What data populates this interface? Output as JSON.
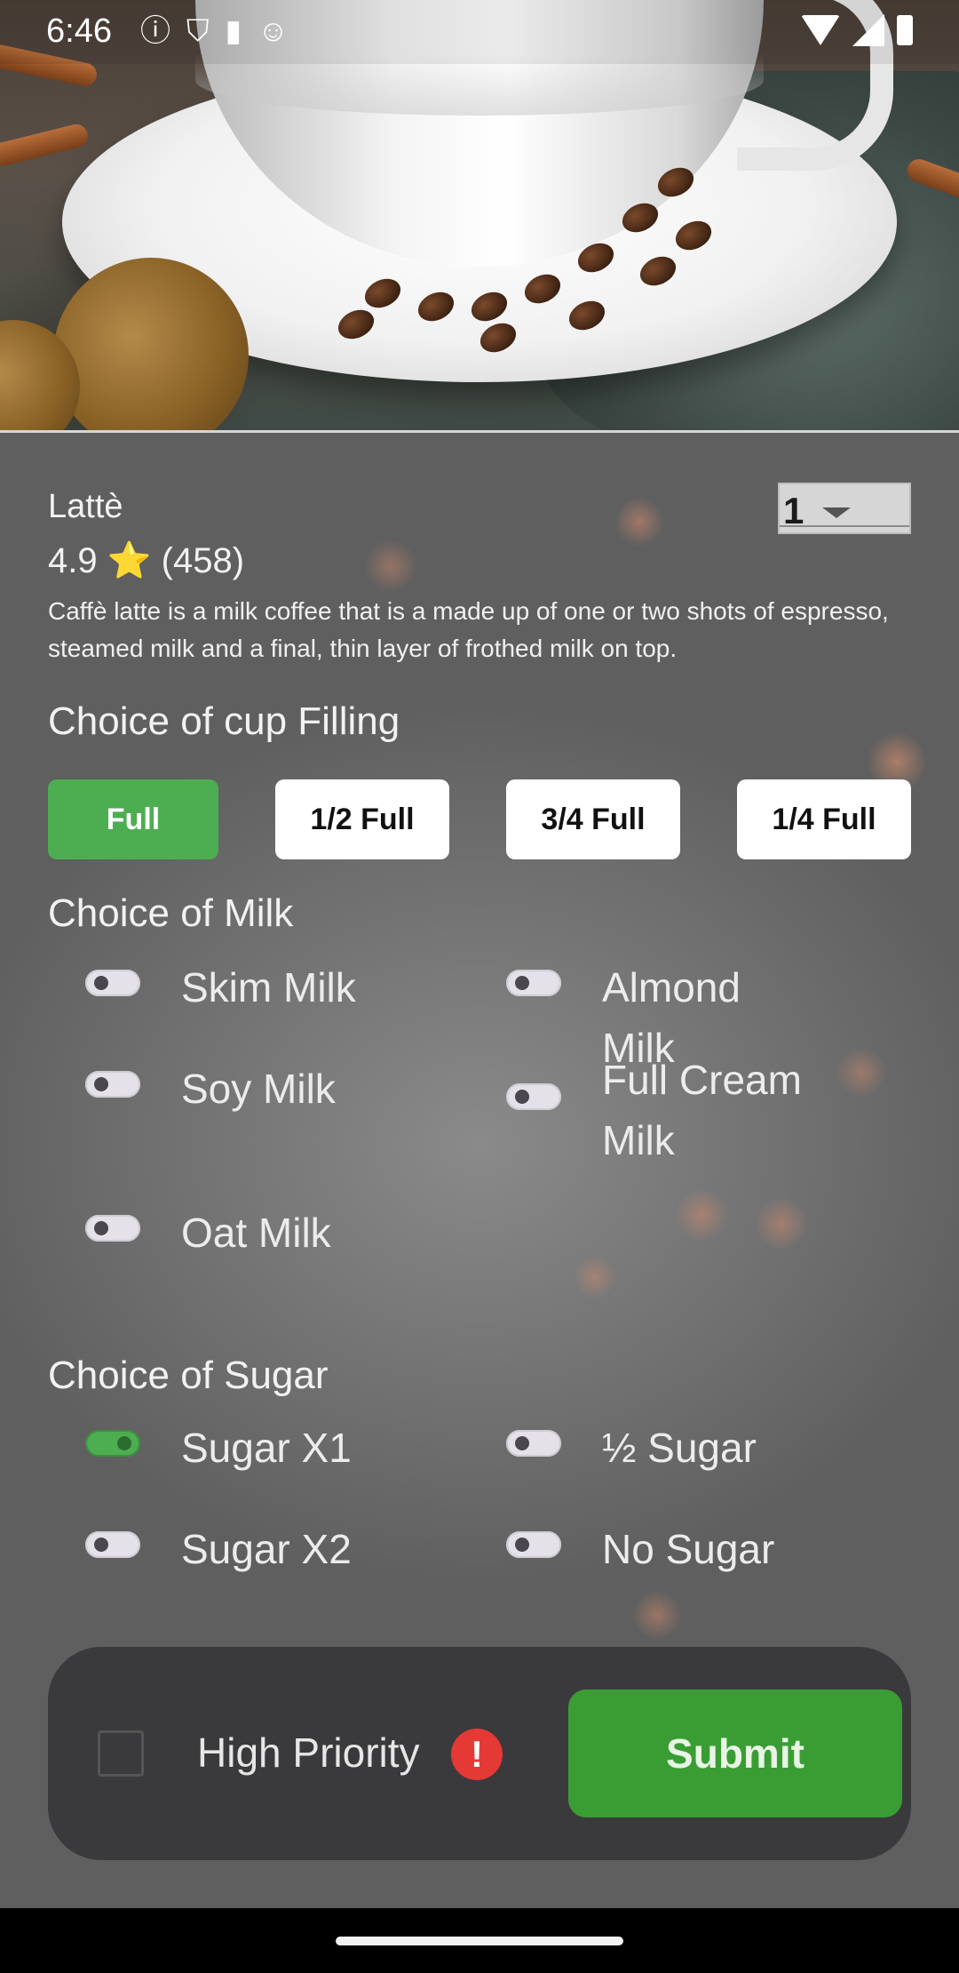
{
  "status_bar": {
    "time": "6:46",
    "notification_icons": [
      "info-icon",
      "shield-icon",
      "sd-card-icon",
      "cat-face-icon"
    ],
    "system_icons": [
      "wifi-icon",
      "signal-icon",
      "battery-icon"
    ]
  },
  "product": {
    "name": "Lattè",
    "rating_text": "4.9 ⭐ (458)",
    "description": "Caffè latte is a milk coffee that is a made up of one or two shots of espresso, steamed milk and a final, thin layer of frothed milk on top.",
    "quantity": "1"
  },
  "cup_filling": {
    "heading": "Choice of cup Filling",
    "options": [
      {
        "label": "Full",
        "selected": true
      },
      {
        "label": "1/2 Full",
        "selected": false
      },
      {
        "label": "3/4 Full",
        "selected": false
      },
      {
        "label": "1/4 Full",
        "selected": false
      }
    ]
  },
  "milk": {
    "heading": "Choice of Milk",
    "options": [
      {
        "label": "Skim Milk",
        "on": false
      },
      {
        "label": "Almond Milk",
        "on": false
      },
      {
        "label": "Soy Milk",
        "on": false
      },
      {
        "label": "Full Cream Milk",
        "on": false
      },
      {
        "label": "Oat Milk",
        "on": false
      }
    ]
  },
  "sugar": {
    "heading": "Choice of Sugar",
    "options": [
      {
        "label": "Sugar X1",
        "on": true
      },
      {
        "label": "½ Sugar",
        "on": false
      },
      {
        "label": "Sugar X2",
        "on": false
      },
      {
        "label": "No Sugar",
        "on": false
      }
    ]
  },
  "order_panel": {
    "priority_label": "High Priority",
    "priority_checked": false,
    "alert_glyph": "!",
    "submit_label": "Submit"
  },
  "colors": {
    "accent_green": "#4cae50",
    "submit_green": "#3a9d34",
    "alert_red": "#e53935",
    "panel_dark": "#3a3a3c"
  }
}
